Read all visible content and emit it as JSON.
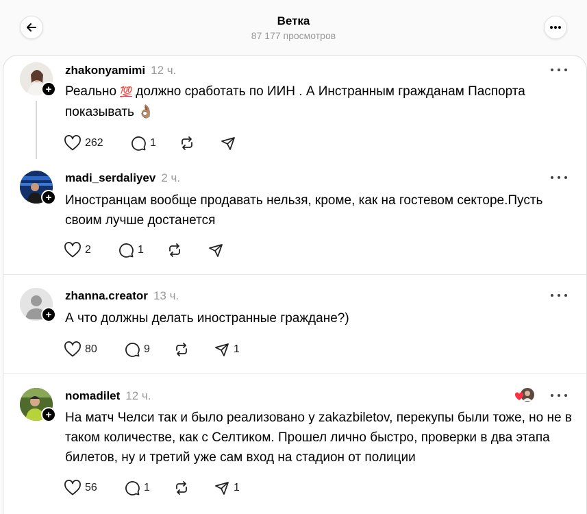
{
  "header": {
    "title": "Ветка",
    "views": "87 177 просмотров"
  },
  "posts": [
    {
      "username": "zhakonyamimi",
      "time": "12 ч.",
      "text_before": "Реально ",
      "emoji": "💯",
      "text_after": " должно сработать по ИИН . А Инстранным гражданам Паспорта показывать",
      "emoji2": "👌🏽",
      "likes": "262",
      "replies": "1",
      "reposts": "",
      "shares": ""
    },
    {
      "username": "madi_serdaliyev",
      "time": "2 ч.",
      "text": "Иностранцам вообще продавать нельзя, кроме, как на гостевом секторе.Пусть своим лучше достанется",
      "likes": "2",
      "replies": "1",
      "reposts": "",
      "shares": ""
    },
    {
      "username": "zhanna.creator",
      "time": "13 ч.",
      "text": "А что должны делать иностранные граждане?)",
      "likes": "80",
      "replies": "9",
      "reposts": "",
      "shares": "1"
    },
    {
      "username": "nomadilet",
      "time": "12 ч.",
      "text": "На матч Челси так и было реализовано у zakazbiletov, перекупы были тоже, но не в таком количестве, как с Селтиком. Прошел лично быстро, проверки в два этапа билетов, ну и третий уже сам вход на стадион от полиции",
      "likes": "56",
      "replies": "1",
      "reposts": "",
      "shares": "1"
    }
  ],
  "icons": {
    "back": "arrow-left-icon",
    "more": "more-horizontal-icon",
    "like": "heart-icon",
    "reply": "comment-icon",
    "repost": "repost-icon",
    "share": "send-icon",
    "follow": "plus-icon"
  },
  "colors": {
    "background": "#fafafa",
    "card": "#ffffff",
    "muted": "#999999",
    "liked_heart": "#ff3040"
  }
}
